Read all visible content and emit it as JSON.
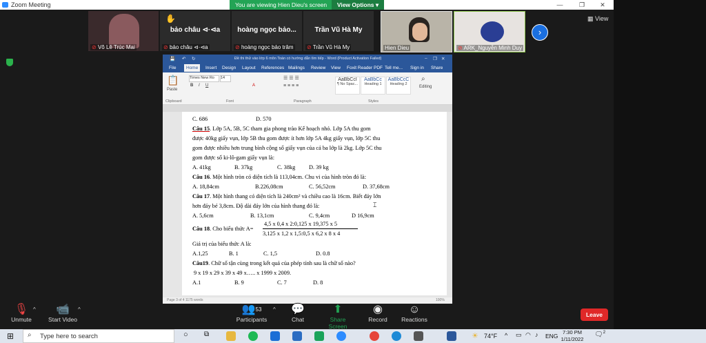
{
  "zoom": {
    "window_title": "Zoom Meeting",
    "viewing_message": "You are viewing Hien Dieu's screen",
    "view_options": "View Options",
    "view_button": "View",
    "next_arrow": "›"
  },
  "participants": [
    {
      "display_name": "",
      "label": "Võ Lê Trúc Mai"
    },
    {
      "display_name": "bảo châu ⊲·⊲a",
      "label": "bảo châu ⊲·⊲a"
    },
    {
      "display_name": "hoàng ngọc bảo...",
      "label": "hoàng ngọc bảo trâm"
    },
    {
      "display_name": "Trần Vũ Hà My",
      "label": "Trần Vũ Hà My"
    },
    {
      "display_name": "",
      "label": "Hien Dieu"
    },
    {
      "display_name": "",
      "label": "ARK_Nguyễn Minh Duy"
    }
  ],
  "word": {
    "title": "Đề thi thử vào lớp 6 môn Toán có hướng dẫn tìm tiếp - Word (Product Activation Failed)",
    "tabs": [
      "File",
      "Home",
      "Insert",
      "Design",
      "Layout",
      "References",
      "Mailings",
      "Review",
      "View",
      "Foxit Reader PDF",
      "Tell me...",
      "Sign in",
      "Share"
    ],
    "font_name": "Times New Ro",
    "font_size": "14",
    "paste_label": "Paste",
    "editing_label": "Editing",
    "groups": [
      "Clipboard",
      "Font",
      "Paragraph",
      "Styles"
    ],
    "styles": [
      {
        "preview": "AaBbCcI",
        "name": "¶ No Spac..."
      },
      {
        "preview": "AaBbCc",
        "name": "Heading 1"
      },
      {
        "preview": "AaBbCcC",
        "name": "Heading 2"
      }
    ],
    "status_left": "Page 3 of 4   1175 words",
    "status_right": "100%"
  },
  "document": {
    "line0": [
      "C. 686",
      "D. 570"
    ],
    "q15": {
      "label": "Câu 15",
      "lines": [
        ". Lớp 5A, 5B, 5C tham gia phong trào Kế hoạch nhỏ. Lớp 5A thu gom",
        "được 40kg giấy vụn, lớp 5B thu gom được ít hơn lớp 5A 4kg giấy vụn, lớp 5C thu",
        "gom được nhiều hơn trung bình cộng số giấy vụn của cả ba lớp là 2kg. Lớp 5C thu",
        "gom được số ki-lô-gam giấy vụn là:"
      ],
      "options": [
        "A. 41kg",
        "B. 37kg",
        "C. 38kg",
        "D. 39 kg"
      ]
    },
    "q16": {
      "label": "Câu 16",
      "text": ". Một hình tròn có diện tích là 113,04cm. Chu vi của hình tròn đó là:",
      "options": [
        "A. 18,84cm",
        "B.226,08cm",
        "C. 56,52cm",
        "D. 37,68cm"
      ]
    },
    "q17": {
      "label": "Câu 17",
      "lines": [
        ". Một hình thang có diện tích là 240cm² và chiều cao là 16cm. Biết đáy lớn",
        "hơn đáy bé 3,8cm. Độ dài đáy lớn của hình thang đó là:"
      ],
      "options": [
        "A. 5,6cm",
        "B. 13,1cm",
        "C. 9,4cm",
        "D 16,9cm"
      ]
    },
    "q18": {
      "label": "Câu 18",
      "text": ". Cho biểu thức A=",
      "numerator": "4,5 x 0,4 x 2:0,125 x 19,375 x 5",
      "denominator": "3,125 x 1,2 x 1,5:0,5 x 6,2 x 8 x 4",
      "line2": "Giá trị của biểu thức A là:",
      "options": [
        "A.1,25",
        "B. 1",
        "C. 1,5",
        "D. 0.8"
      ]
    },
    "q19": {
      "label": "Câu19",
      "text": ". Chữ số tận cùng trong kết quả của phép tính sau là chữ số nào?",
      "expr": "9 x 19 x 29 x 39 x 49 x….. x 1999 x 2009.",
      "options": [
        "A.1",
        "B. 9",
        "C. 7",
        "D. 8"
      ]
    }
  },
  "toolbar": {
    "unmute": "Unmute",
    "start_video": "Start Video",
    "participants": "Participants",
    "participants_count": "53",
    "chat": "Chat",
    "share_screen": "Share Screen",
    "record": "Record",
    "reactions": "Reactions",
    "leave": "Leave"
  },
  "taskbar": {
    "search_placeholder": "Type here to search",
    "weather": "74°F",
    "language": "ENG",
    "time": "7:30 PM",
    "date": "1/11/2022",
    "notification_count": "2"
  },
  "colors": {
    "zoom_bg": "#1a1a1a",
    "viewing_green": "#23a455",
    "word_blue": "#2b579a",
    "leave_red": "#e02828",
    "share_green": "#23a455"
  }
}
